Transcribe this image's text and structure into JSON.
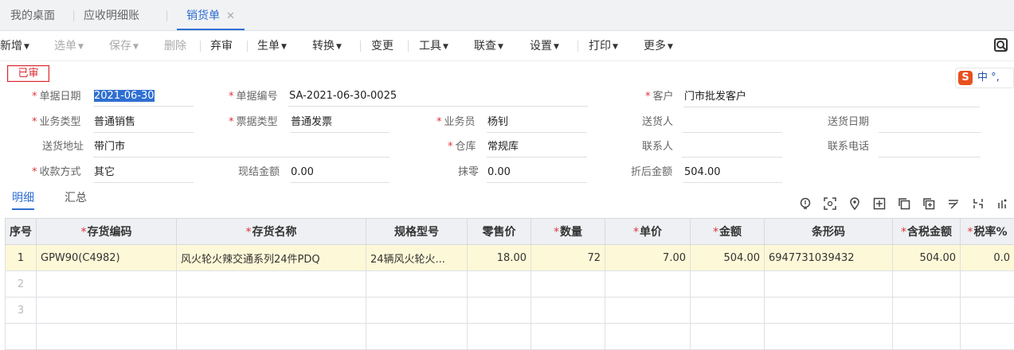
{
  "tabs": [
    {
      "label": "我的桌面"
    },
    {
      "label": "应收明细账"
    },
    {
      "label": "销货单",
      "close": "✕"
    }
  ],
  "toolbar": {
    "new": "新增",
    "select": "选单",
    "save": "保存",
    "delete": "删除",
    "abandon": "弃审",
    "generate": "生单",
    "convert": "转换",
    "change": "变更",
    "tools": "工具",
    "link": "联查",
    "settings": "设置",
    "print": "打印",
    "more": "更多"
  },
  "status_badge": "已审",
  "ime": {
    "logo": "S",
    "text": "中 °,"
  },
  "form": {
    "doc_date": {
      "label": "单据日期",
      "value": "2021-06-30"
    },
    "doc_no": {
      "label": "单据编号",
      "value": "SA-2021-06-30-0025"
    },
    "customer": {
      "label": "客户",
      "value": "门市批发客户"
    },
    "biz_type": {
      "label": "业务类型",
      "value": "普通销售"
    },
    "invoice_type": {
      "label": "票据类型",
      "value": "普通发票"
    },
    "salesman": {
      "label": "业务员",
      "value": "杨钊"
    },
    "deliverer": {
      "label": "送货人",
      "value": ""
    },
    "delivery_date": {
      "label": "送货日期",
      "value": ""
    },
    "delivery_addr": {
      "label": "送货地址",
      "value": "带门市"
    },
    "warehouse": {
      "label": "仓库",
      "value": "常规库"
    },
    "contact": {
      "label": "联系人",
      "value": ""
    },
    "phone": {
      "label": "联系电话",
      "value": ""
    },
    "payment": {
      "label": "收款方式",
      "value": "其它"
    },
    "cash_amount": {
      "label": "现结金额",
      "value": "0.00"
    },
    "rounding": {
      "label": "抹零",
      "value": "0.00"
    },
    "discount_amount": {
      "label": "折后金额",
      "value": "504.00"
    }
  },
  "subtabs": {
    "detail": "明细",
    "summary": "汇总"
  },
  "grid": {
    "columns": [
      {
        "label": "序号",
        "required": false
      },
      {
        "label": "存货编码",
        "required": true
      },
      {
        "label": "存货名称",
        "required": true
      },
      {
        "label": "规格型号",
        "required": false
      },
      {
        "label": "零售价",
        "required": false
      },
      {
        "label": "数量",
        "required": true
      },
      {
        "label": "单价",
        "required": true
      },
      {
        "label": "金额",
        "required": true
      },
      {
        "label": "条形码",
        "required": false
      },
      {
        "label": "含税金额",
        "required": true
      },
      {
        "label": "税率%",
        "required": true
      }
    ],
    "rows": [
      {
        "idx": "1",
        "code": "GPW90(C4982)",
        "name": "风火轮火辣交通系列24件PDQ",
        "spec": "24辆风火轮火...",
        "retail": "18.00",
        "qty": "72",
        "price": "7.00",
        "amount": "504.00",
        "barcode": "6947731039432",
        "tax_amount": "504.00",
        "tax_rate": "0.0"
      },
      {
        "idx": "2",
        "code": "",
        "name": "",
        "spec": "",
        "retail": "",
        "qty": "",
        "price": "",
        "amount": "",
        "barcode": "",
        "tax_amount": "",
        "tax_rate": ""
      },
      {
        "idx": "3",
        "code": "",
        "name": "",
        "spec": "",
        "retail": "",
        "qty": "",
        "price": "",
        "amount": "",
        "barcode": "",
        "tax_amount": "",
        "tax_rate": ""
      },
      {
        "idx": "",
        "code": "",
        "name": "",
        "spec": "",
        "retail": "",
        "qty": "",
        "price": "",
        "amount": "",
        "barcode": "",
        "tax_amount": "",
        "tax_rate": ""
      }
    ]
  },
  "colors": {
    "accent": "#2f6fd1",
    "required": "#e0333a",
    "selected_row": "#fdf8d7"
  }
}
